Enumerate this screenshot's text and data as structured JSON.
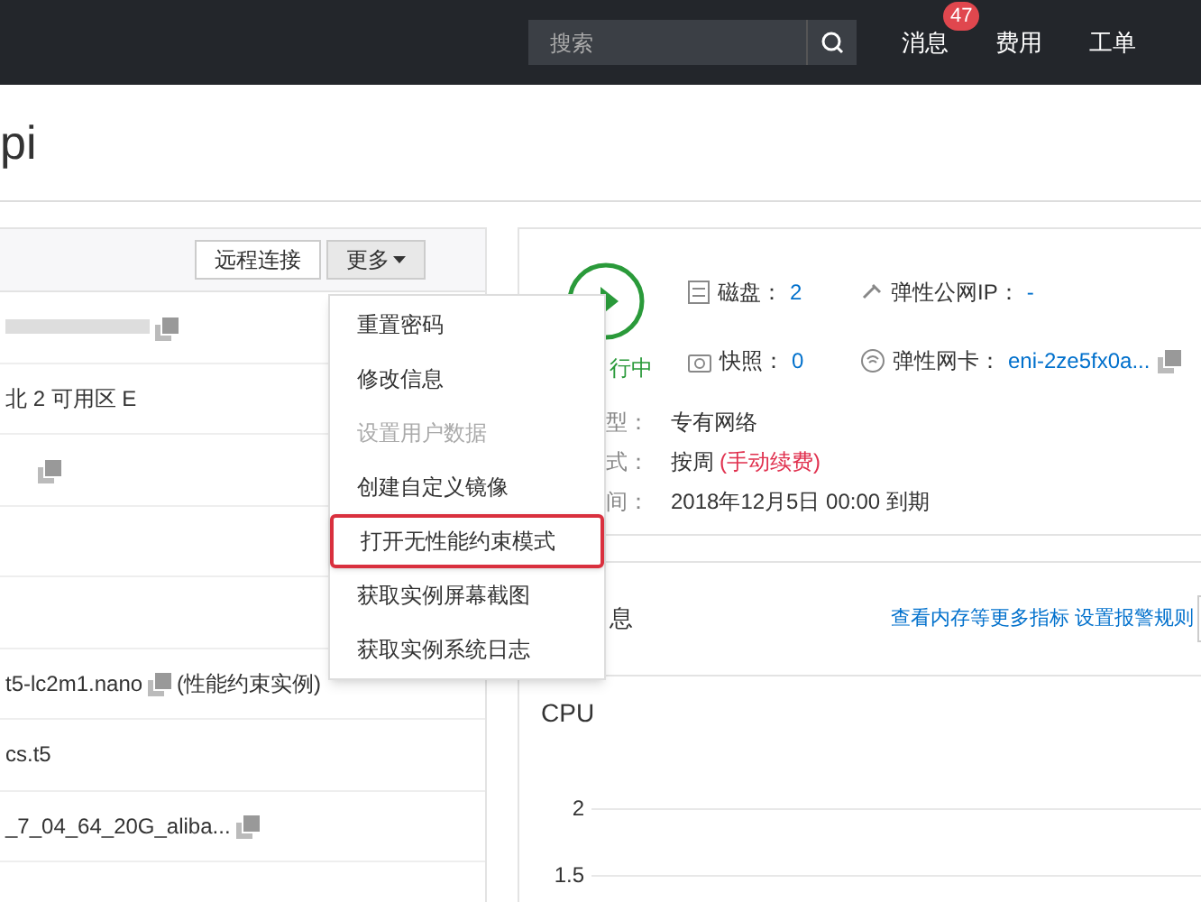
{
  "topbar": {
    "search": {
      "placeholder": "搜索"
    },
    "nav": [
      {
        "label": "消息",
        "badge": "47"
      },
      {
        "label": "费用"
      },
      {
        "label": "工单"
      }
    ]
  },
  "page_title": "pi",
  "toolbar": {
    "buttons": [
      {
        "label": "远程连接",
        "pressed": false
      },
      {
        "label": "更多",
        "pressed": true,
        "caret": true
      }
    ]
  },
  "info_rows": [
    {
      "text": "",
      "copy": true,
      "blurred": true
    },
    {
      "text": "北 2 可用区 E",
      "copy": false
    },
    {
      "text": "",
      "copy": true
    },
    {
      "text": "",
      "copy": false
    },
    {
      "text": "",
      "copy": false
    },
    {
      "text": "t5-lc2m1.nano",
      "copy": true,
      "note": "(性能约束实例)"
    },
    {
      "text": "cs.t5",
      "copy": false
    },
    {
      "text": "_7_04_64_20G_aliba...",
      "copy": true
    }
  ],
  "more_menu": [
    {
      "label": "重置密码",
      "disabled": false,
      "selected": false
    },
    {
      "label": "修改信息",
      "disabled": false,
      "selected": false
    },
    {
      "label": "设置用户数据",
      "disabled": true,
      "selected": false
    },
    {
      "label": "创建自定义镜像",
      "disabled": false,
      "selected": false
    },
    {
      "label": "打开无性能约束模式",
      "disabled": false,
      "selected": true
    },
    {
      "label": "获取实例屏幕截图",
      "disabled": false,
      "selected": false
    },
    {
      "label": "获取实例系统日志",
      "disabled": false,
      "selected": false
    }
  ],
  "status": {
    "label": "行中"
  },
  "resources": [
    {
      "kind": "disk",
      "label": "磁盘：",
      "value": "2"
    },
    {
      "kind": "ip",
      "label": "弹性公网IP：",
      "value": "-"
    },
    {
      "kind": "snapshot",
      "label": "快照：",
      "value": "0"
    },
    {
      "kind": "nic",
      "label": "弹性网卡：",
      "value": "eni-2ze5fx0a...",
      "copy": true
    }
  ],
  "details": [
    {
      "label": "型：",
      "value": "专有网络"
    },
    {
      "label": "式：",
      "value": "按周",
      "note": "(手动续费)"
    },
    {
      "label": "间：",
      "value": "2018年12月5日 00:00 到期"
    }
  ],
  "monitor": {
    "title": "息",
    "links": [
      "查看内存等更多指标",
      "设置报警规则"
    ],
    "chart": {
      "title": "CPU",
      "y_ticks": [
        "2",
        "1.5"
      ]
    }
  }
}
